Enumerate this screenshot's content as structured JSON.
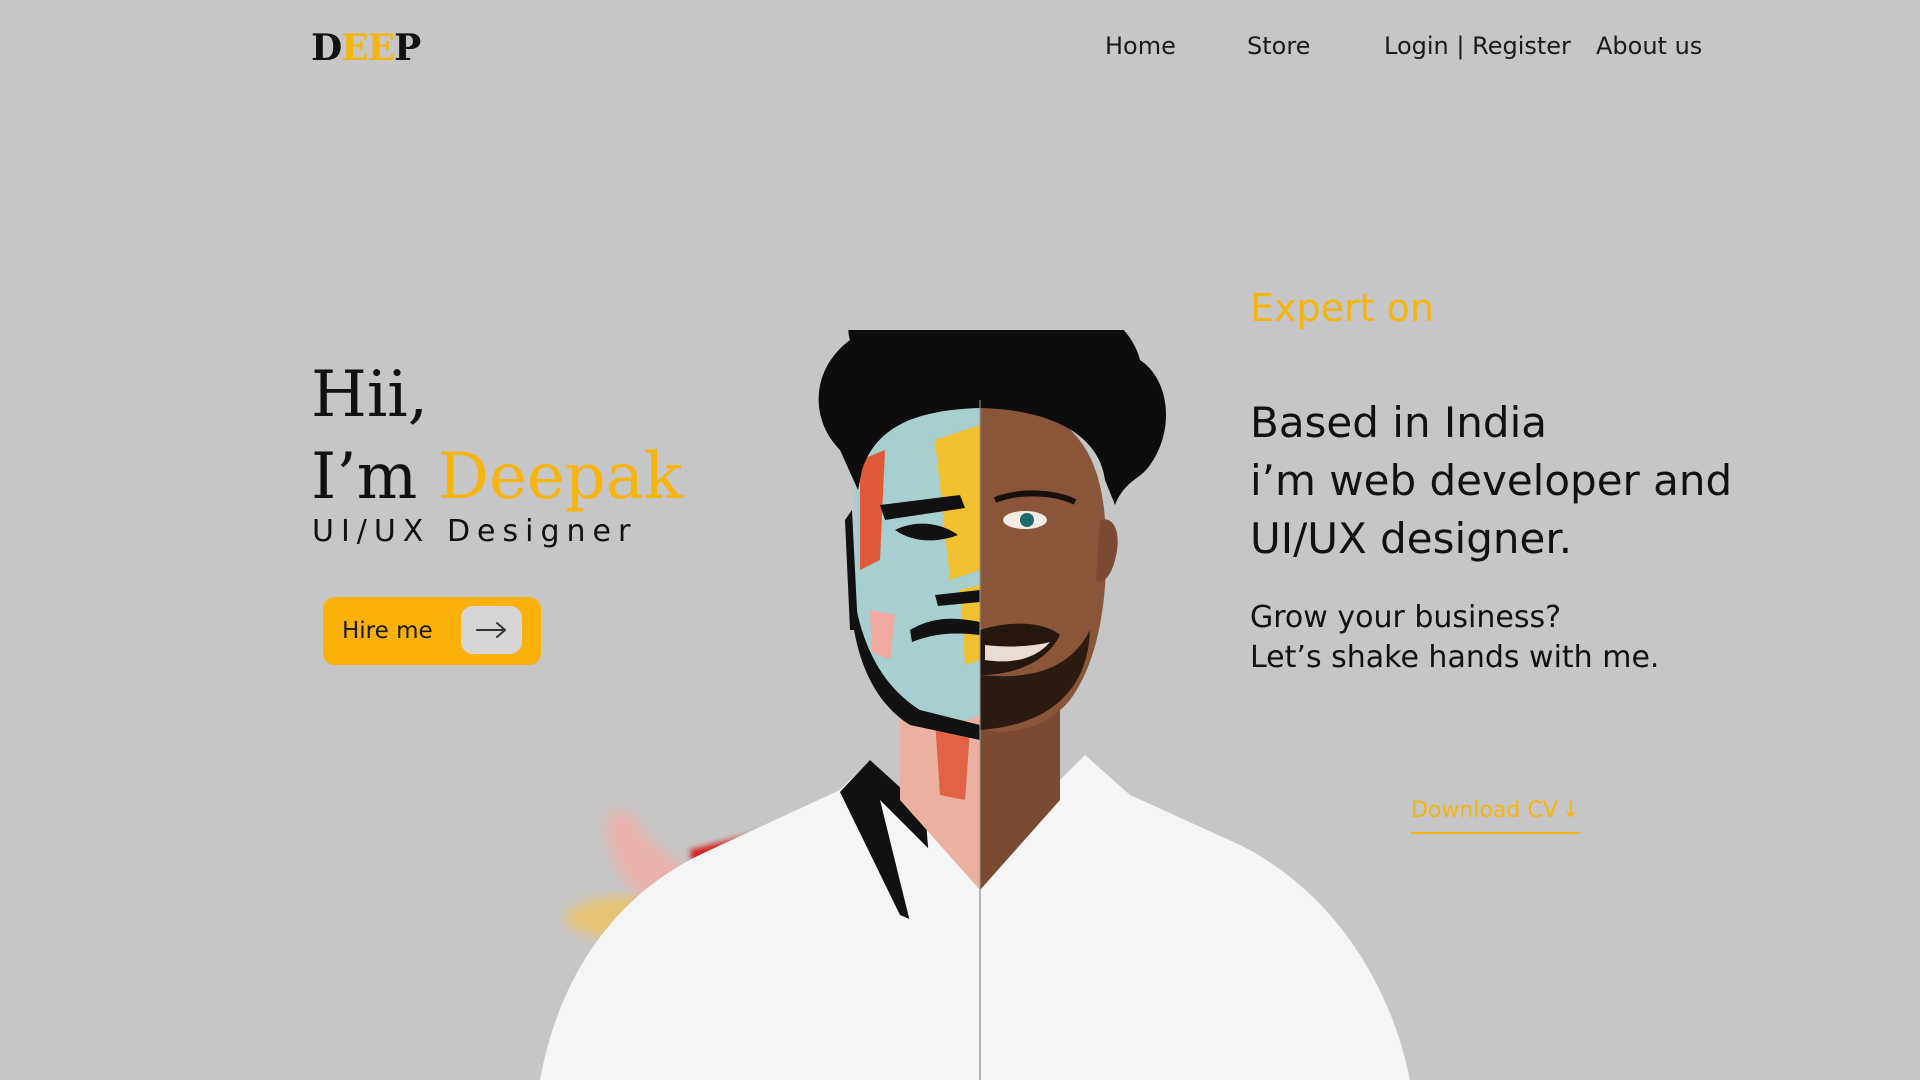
{
  "header": {
    "logo": {
      "part1": "D",
      "part2": "EE",
      "part3": "P"
    },
    "nav": [
      {
        "label": "Home"
      },
      {
        "label": "Store"
      },
      {
        "label": "Login | Register"
      },
      {
        "label": "About us"
      }
    ]
  },
  "hero": {
    "greeting": "Hii,",
    "intro": "I’m ",
    "name": "Deepak",
    "role": "UI/UX Designer",
    "hire_button": {
      "label": "Hire me",
      "icon": "arrow-right-icon"
    }
  },
  "about": {
    "heading": "Expert on",
    "bio_lines": [
      "Based in India",
      "i’m web developer and",
      "UI/UX designer."
    ],
    "cta_lines": [
      "Grow your business?",
      "Let’s shake hands with me."
    ],
    "download": {
      "label": "Download CV",
      "icon": "arrow-down-icon",
      "glyph": "↓"
    }
  },
  "colors": {
    "background": "#c6c6c6",
    "accent": "#f6b40e",
    "button": "#fab10a",
    "text": "#111111"
  }
}
